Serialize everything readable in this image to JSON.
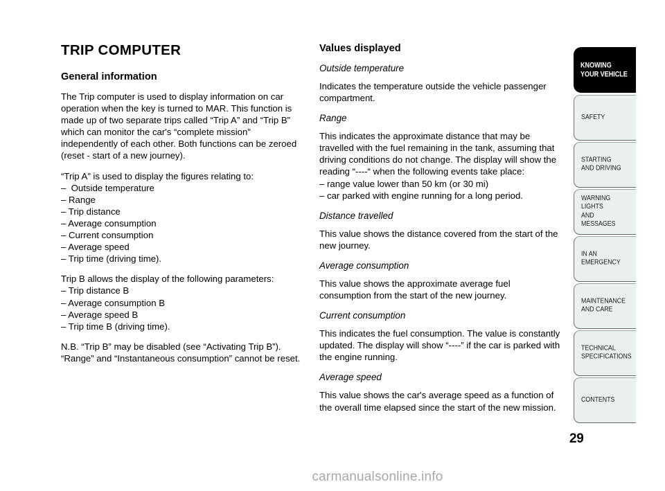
{
  "document": {
    "page_number": "29",
    "watermark": "carmanualsonline.info"
  },
  "left_column": {
    "title": "TRIP COMPUTER",
    "section_heading": "General information",
    "paragraph_1": "The Trip computer is used to display information on car operation when the key is turned to MAR. This function is made up of two separate trips called “Trip A” and “Trip B” which can monitor the car's “complete mission” independently of each other. Both functions can be zeroed",
    "paragraph_1b": "(reset - start of a new journey).",
    "trip_a_intro": "“Trip A” is used to display the figures relating to:",
    "trip_a_items": [
      "–  Outside temperature",
      "– Range",
      "– Trip distance",
      "– Average consumption",
      "– Current consumption",
      "– Average speed",
      "– Trip time (driving time)."
    ],
    "trip_b_intro": "Trip B allows the display of the following parameters:",
    "trip_b_items": [
      "– Trip distance B",
      "– Average consumption B",
      "– Average speed B",
      "– Trip time B (driving time)."
    ],
    "note": "N.B. “Trip B” may be disabled (see “Activating Trip B”). “Range” and “Instantaneous consumption” cannot be reset."
  },
  "right_column": {
    "section_heading": "Values displayed",
    "entries": [
      {
        "heading": "Outside temperature",
        "body": "Indicates the temperature outside the vehicle passenger compartment."
      },
      {
        "heading": "Range",
        "body": "This indicates the approximate distance that may be travelled with the fuel remaining in the tank, assuming that driving conditions do not change. The display will show the reading “----“ when the following events take place:",
        "items": [
          "– range value lower than 50 km (or 30 mi)",
          "– car parked with engine running for a long period."
        ]
      },
      {
        "heading": "Distance travelled",
        "body": "This value shows the distance covered from the start of the new journey."
      },
      {
        "heading": "Average consumption",
        "body": "This value shows the approximate average fuel consumption from the start of the new journey."
      },
      {
        "heading": "Current consumption",
        "body": "This indicates the fuel consumption. The value is constantly updated. The display will show “----” if the car is parked with the engine running."
      },
      {
        "heading": "Average speed",
        "body": "This value shows the car's average speed as a function of the overall time elapsed since the start of the new mission."
      }
    ]
  },
  "tab_rail": {
    "tabs": [
      {
        "label": "KNOWING\nYOUR VEHICLE",
        "active": true
      },
      {
        "label": "SAFETY",
        "active": false
      },
      {
        "label": "STARTING\nAND DRIVING",
        "active": false
      },
      {
        "label": "WARNING LIGHTS\nAND MESSAGES",
        "active": false
      },
      {
        "label": "IN AN\nEMERGENCY",
        "active": false
      },
      {
        "label": "MAINTENANCE\nAND CARE",
        "active": false
      },
      {
        "label": "TECHNICAL\nSPECIFICATIONS",
        "active": false
      },
      {
        "label": "CONTENTS",
        "active": false
      }
    ]
  },
  "colors": {
    "active_tab_bg": "#000000",
    "tab_bg": "#eaefef",
    "text": "#000000",
    "watermark": "#a8a8a8"
  }
}
